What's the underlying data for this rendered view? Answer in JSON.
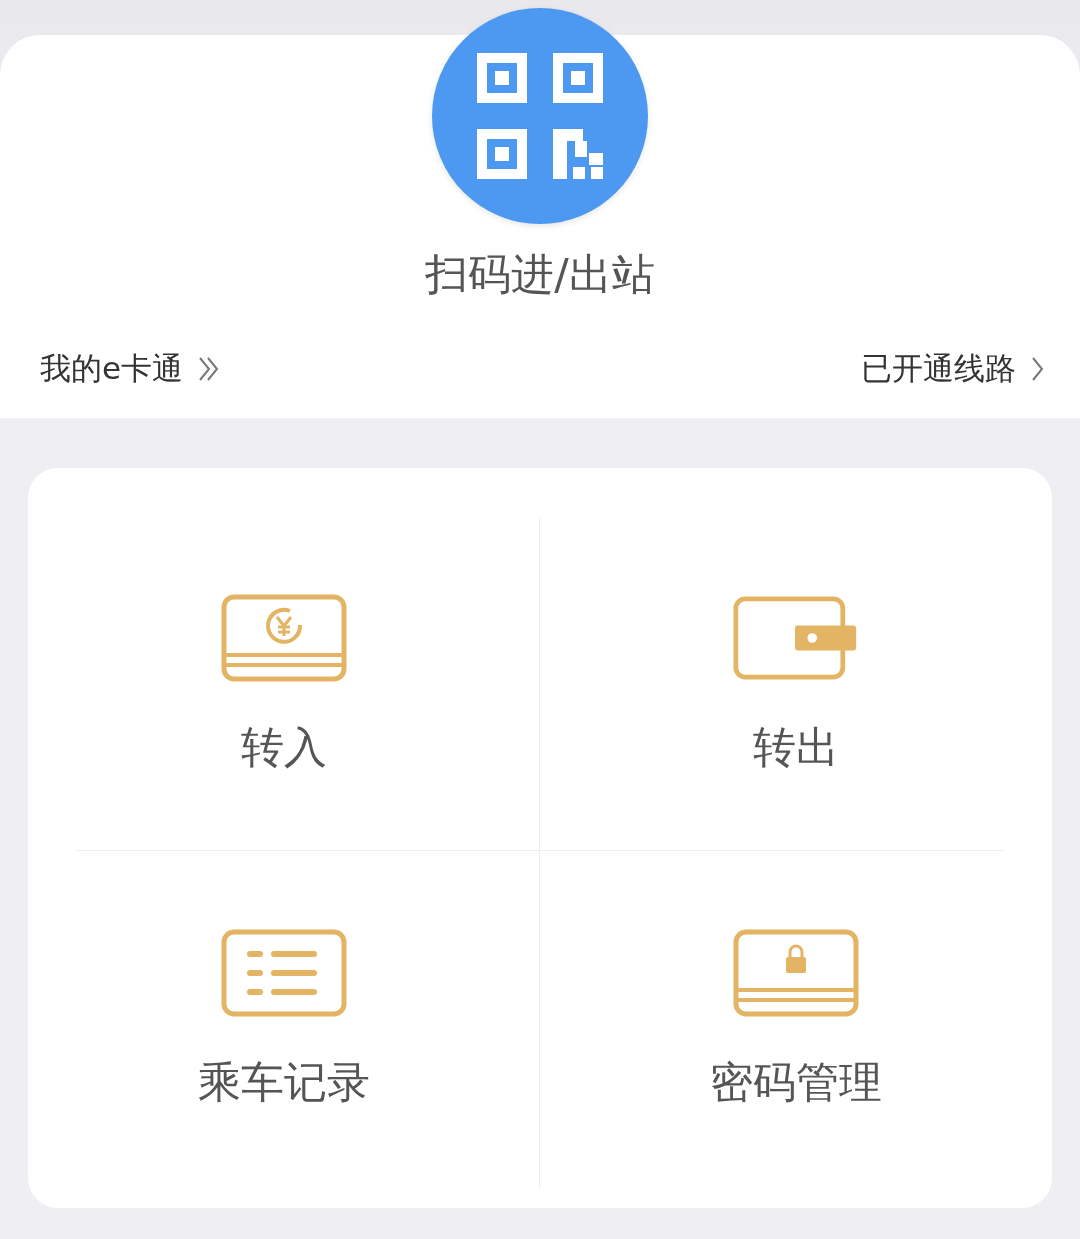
{
  "scan": {
    "label": "扫码进/出站"
  },
  "links": [
    {
      "label": "我的e卡通",
      "kind": "double"
    },
    {
      "label": "已开通线路",
      "kind": "single"
    }
  ],
  "actions": [
    {
      "label": "转入",
      "kind": "deposit"
    },
    {
      "label": "转出",
      "kind": "wallet"
    },
    {
      "label": "乘车记录",
      "kind": "records"
    },
    {
      "label": "密码管理",
      "kind": "lock"
    }
  ]
}
